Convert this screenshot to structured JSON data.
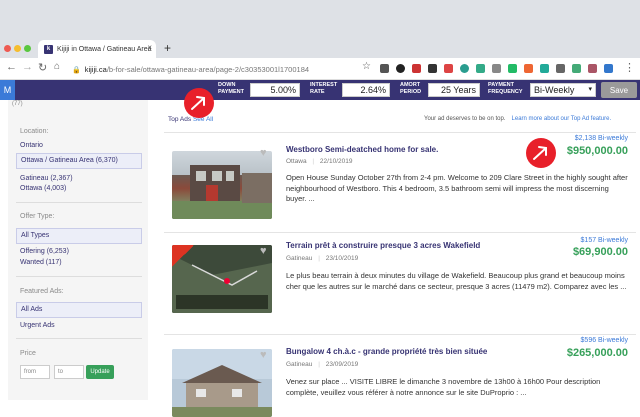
{
  "browser": {
    "tab_title": "Kijiji in Ottawa / Gatineau Area",
    "url_domain": "kijiji.ca",
    "url_path": "/b-for-sale/ottawa-gatineau-area/page-2/c30353001l1700184"
  },
  "toolbar": {
    "logo": "M",
    "down_payment_label": "DOWN PAYMENT",
    "down_payment_value": "5.00%",
    "interest_label": "INTEREST RATE",
    "interest_value": "2.64%",
    "amort_label": "AMORT PERIOD",
    "amort_value": "25 Years",
    "freq_label": "PAYMENT FREQUENCY",
    "freq_value": "Bi-Weekly",
    "save_label": "Save"
  },
  "sidebar": {
    "count": "(77)",
    "location_heading": "Location:",
    "location_items": [
      {
        "label": "Ontario"
      },
      {
        "label": "Ottawa / Gatineau Area (6,370)"
      },
      {
        "label": "Gatineau (2,367)"
      },
      {
        "label": "Ottawa (4,003)"
      }
    ],
    "offer_heading": "Offer Type:",
    "offer_items": [
      {
        "label": "All Types"
      },
      {
        "label": "Offering (6,253)"
      },
      {
        "label": "Wanted (117)"
      }
    ],
    "featured_heading": "Featured Ads:",
    "featured_items": [
      {
        "label": "All Ads"
      },
      {
        "label": "Urgent Ads"
      }
    ],
    "price_heading": "Price",
    "from_placeholder": "from",
    "to_placeholder": "to",
    "update_label": "Update"
  },
  "main": {
    "top_ads_label": "Top Ads",
    "top_ads_link": "See All",
    "top_ad_note": "Your ad deserves to be on top.",
    "top_ad_link": "Learn more about our Top Ad feature.",
    "listings": [
      {
        "title": "Westboro Semi-deatched home for sale.",
        "location": "Ottawa",
        "date": "22/10/2019",
        "description": "Open House Sunday October 27th from 2-4 pm. Welcome to 209 Clare Street in the highly sought after neighbourhood of Westboro. This 4 bedroom, 3.5 bathroom semi will impress the most discerning buyer. ...",
        "biweekly": "$2,138 Bi-weekly",
        "price": "$950,000.00"
      },
      {
        "title": "Terrain prêt à construire presque 3 acres Wakefield",
        "location": "Gatineau",
        "date": "23/10/2019",
        "description": "Le plus beau terrain à deux minutes du village de Wakefield. Beaucoup plus grand et beaucoup moins cher que les autres sur le marché dans ce secteur, presque 3 acres (11479 m2). Comparez avec les ...",
        "biweekly": "$157 Bi-weekly",
        "price": "$69,900.00"
      },
      {
        "title": "Bungalow 4 ch.à.c - grande propriété très bien située",
        "location": "Gatineau",
        "date": "23/09/2019",
        "description": "Venez sur place ... VISITE LIBRE le dimanche 3 novembre de 13h00 à 16h00 Pour description complète, veuillez vous référer à notre annonce sur le site DuProprio : ...",
        "biweekly": "$596 Bi-weekly",
        "price": "$265,000.00"
      }
    ]
  },
  "colors": {
    "brand": "#373373",
    "price_green": "#37a05a",
    "link_blue": "#3b7ad8",
    "arrow_red": "#e8202a"
  }
}
